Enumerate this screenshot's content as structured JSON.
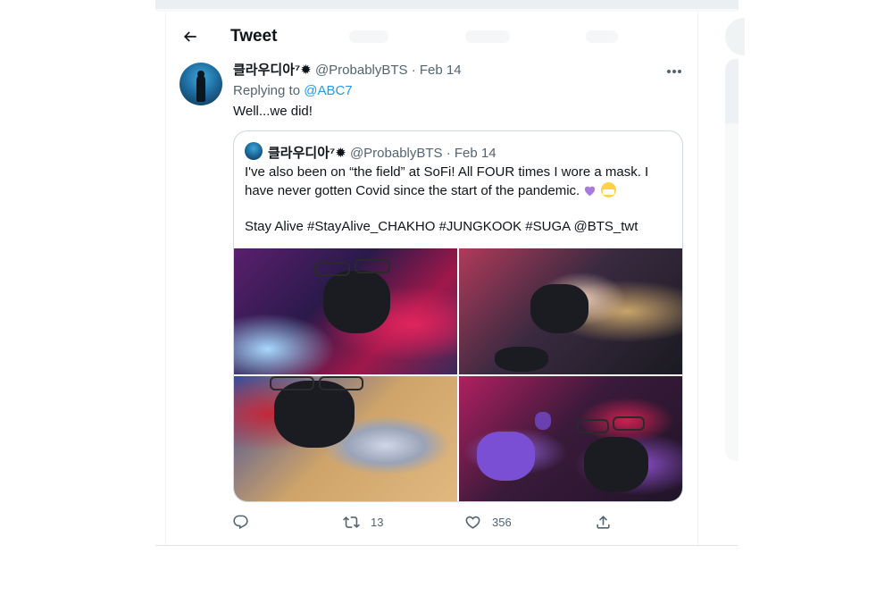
{
  "header": {
    "title": "Tweet"
  },
  "tweet": {
    "display_name": "클라우디아⁷✹",
    "handle": "@ProbablyBTS",
    "separator": "·",
    "date": "Feb 14",
    "replying_prefix": "Replying to",
    "replying_to": "@ABC7",
    "text": "Well...we did!"
  },
  "quoted": {
    "display_name": "클라우디아⁷✹",
    "handle": "@ProbablyBTS",
    "separator": "·",
    "date": "Feb 14",
    "text_line1": "I've also been on “the field” at SoFi! All FOUR times I wore a mask. I have never gotten Covid since the start of the pandemic.",
    "text_line2": "Stay Alive #StayAlive_CHAKHO #JUNGKOOK #SUGA @BTS_twt",
    "media": [
      {
        "icon": "photo-1"
      },
      {
        "icon": "photo-2"
      },
      {
        "icon": "photo-3"
      },
      {
        "icon": "photo-4"
      }
    ]
  },
  "actions": {
    "reply_count": "",
    "retweet_count": "13",
    "like_count": "356"
  },
  "colors": {
    "accent": "#1d9bf0",
    "text": "#0f1419",
    "muted": "#536471",
    "border": "#cfd9de"
  }
}
